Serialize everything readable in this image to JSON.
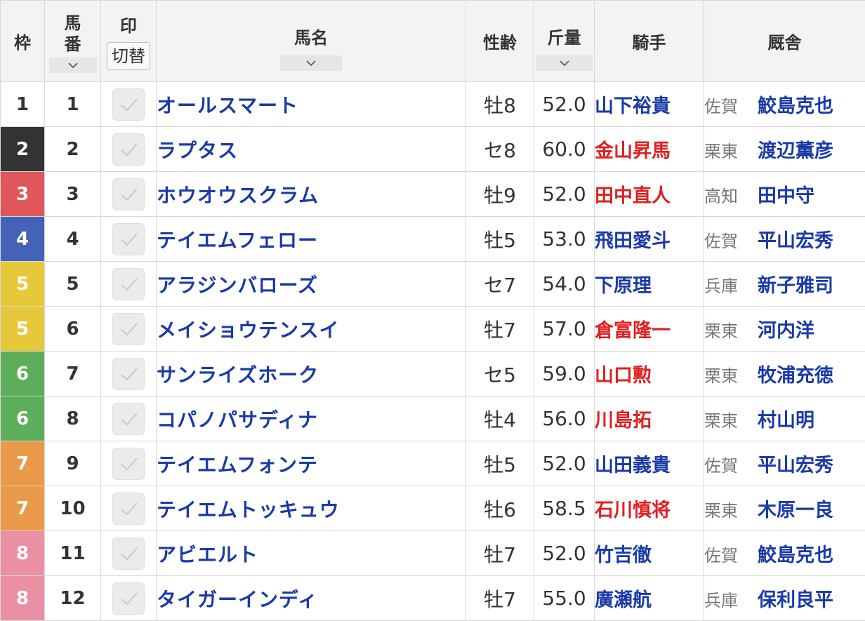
{
  "headers": {
    "waku": "枠",
    "umaban_line1": "馬",
    "umaban_line2": "番",
    "mark": "印",
    "mark_toggle": "切替",
    "horse_name": "馬名",
    "sex_age": "性齢",
    "weight": "斤量",
    "jockey": "騎手",
    "stable": "厩舎"
  },
  "icons": {
    "sort": "chevron-down-icon",
    "check": "check-icon"
  },
  "waku_colors": {
    "1": {
      "bg": "#ffffff",
      "fg": "#333333"
    },
    "2": {
      "bg": "#333333",
      "fg": "#ffffff"
    },
    "3": {
      "bg": "#e0575b",
      "fg": "#ffffff"
    },
    "4": {
      "bg": "#4463b8",
      "fg": "#ffffff"
    },
    "5": {
      "bg": "#e6c83a",
      "fg": "#ffffff"
    },
    "6": {
      "bg": "#5cae5a",
      "fg": "#ffffff"
    },
    "7": {
      "bg": "#ea9a48",
      "fg": "#ffffff"
    },
    "8": {
      "bg": "#ea8fa4",
      "fg": "#ffffff"
    }
  },
  "rows": [
    {
      "waku": "1",
      "umaban": "1",
      "horse": "オールスマート",
      "sexage": "牡8",
      "weight": "52.0",
      "jockey": "山下裕貴",
      "jockey_color": "blue",
      "region": "佐賀",
      "trainer": "鮫島克也"
    },
    {
      "waku": "2",
      "umaban": "2",
      "horse": "ラプタス",
      "sexage": "セ8",
      "weight": "60.0",
      "jockey": "金山昇馬",
      "jockey_color": "red",
      "region": "栗東",
      "trainer": "渡辺薫彦"
    },
    {
      "waku": "3",
      "umaban": "3",
      "horse": "ホウオウスクラム",
      "sexage": "牡9",
      "weight": "52.0",
      "jockey": "田中直人",
      "jockey_color": "red",
      "region": "高知",
      "trainer": "田中守"
    },
    {
      "waku": "4",
      "umaban": "4",
      "horse": "テイエムフェロー",
      "sexage": "牡5",
      "weight": "53.0",
      "jockey": "飛田愛斗",
      "jockey_color": "blue",
      "region": "佐賀",
      "trainer": "平山宏秀"
    },
    {
      "waku": "5",
      "umaban": "5",
      "horse": "アラジンバローズ",
      "sexage": "セ7",
      "weight": "54.0",
      "jockey": "下原理",
      "jockey_color": "blue",
      "region": "兵庫",
      "trainer": "新子雅司"
    },
    {
      "waku": "5",
      "umaban": "6",
      "horse": "メイショウテンスイ",
      "sexage": "牡7",
      "weight": "57.0",
      "jockey": "倉富隆一",
      "jockey_color": "red",
      "region": "栗東",
      "trainer": "河内洋"
    },
    {
      "waku": "6",
      "umaban": "7",
      "horse": "サンライズホーク",
      "sexage": "セ5",
      "weight": "59.0",
      "jockey": "山口勲",
      "jockey_color": "red",
      "region": "栗東",
      "trainer": "牧浦充徳"
    },
    {
      "waku": "6",
      "umaban": "8",
      "horse": "コパノパサディナ",
      "sexage": "牡4",
      "weight": "56.0",
      "jockey": "川島拓",
      "jockey_color": "red",
      "region": "栗東",
      "trainer": "村山明"
    },
    {
      "waku": "7",
      "umaban": "9",
      "horse": "テイエムフォンテ",
      "sexage": "牡5",
      "weight": "52.0",
      "jockey": "山田義貴",
      "jockey_color": "blue",
      "region": "佐賀",
      "trainer": "平山宏秀"
    },
    {
      "waku": "7",
      "umaban": "10",
      "horse": "テイエムトッキュウ",
      "sexage": "牡6",
      "weight": "58.5",
      "jockey": "石川慎将",
      "jockey_color": "red",
      "region": "栗東",
      "trainer": "木原一良"
    },
    {
      "waku": "8",
      "umaban": "11",
      "horse": "アビエルト",
      "sexage": "牡7",
      "weight": "52.0",
      "jockey": "竹吉徹",
      "jockey_color": "blue",
      "region": "佐賀",
      "trainer": "鮫島克也"
    },
    {
      "waku": "8",
      "umaban": "12",
      "horse": "タイガーインディ",
      "sexage": "牡7",
      "weight": "55.0",
      "jockey": "廣瀬航",
      "jockey_color": "blue",
      "region": "兵庫",
      "trainer": "保利良平"
    }
  ]
}
